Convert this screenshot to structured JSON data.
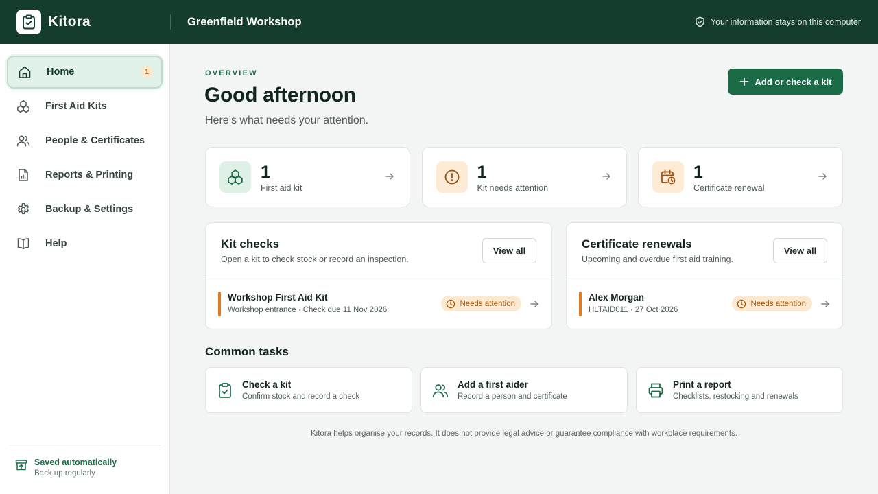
{
  "app": {
    "name": "Kitora",
    "workspace": "Greenfield Workshop",
    "privacy_note": "Your information stays on this computer"
  },
  "sidebar": {
    "items": [
      {
        "label": "Home",
        "icon": "home-icon",
        "badge": "1",
        "active": true
      },
      {
        "label": "First Aid Kits",
        "icon": "kits-icon"
      },
      {
        "label": "People & Certificates",
        "icon": "people-icon"
      },
      {
        "label": "Reports & Printing",
        "icon": "report-icon"
      },
      {
        "label": "Backup & Settings",
        "icon": "gear-icon"
      },
      {
        "label": "Help",
        "icon": "book-icon"
      }
    ],
    "status": {
      "title": "Saved automatically",
      "subtitle": "Back up regularly"
    }
  },
  "main": {
    "eyebrow": "OVERVIEW",
    "greeting": "Good afternoon",
    "subtitle": "Here’s what needs your attention.",
    "primary_action": "Add or check a kit",
    "stats": [
      {
        "value": "1",
        "label": "First aid kit",
        "icon": "kits-icon"
      },
      {
        "value": "1",
        "label": "Kit needs attention",
        "icon": "alert-circle-icon"
      },
      {
        "value": "1",
        "label": "Certificate renewal",
        "icon": "calendar-clock-icon"
      }
    ],
    "kit_checks": {
      "title": "Kit checks",
      "subtitle": "Open a kit to check stock or record an inspection.",
      "view_all": "View all",
      "rows": [
        {
          "title": "Workshop First Aid Kit",
          "meta": "Workshop entrance · Check due 11 Nov 2026",
          "status": "Needs attention"
        }
      ]
    },
    "certificate_renewals": {
      "title": "Certificate renewals",
      "subtitle": "Upcoming and overdue first aid training.",
      "view_all": "View all",
      "rows": [
        {
          "title": "Alex Morgan",
          "meta": "HLTAID011 · 27 Oct 2026",
          "status": "Needs attention"
        }
      ]
    },
    "common_tasks": {
      "title": "Common tasks",
      "items": [
        {
          "title": "Check a kit",
          "subtitle": "Confirm stock and record a check",
          "icon": "clipboard-check-icon"
        },
        {
          "title": "Add a first aider",
          "subtitle": "Record a person and certificate",
          "icon": "people-icon"
        },
        {
          "title": "Print a report",
          "subtitle": "Checklists, restocking and renewals",
          "icon": "printer-icon"
        }
      ]
    },
    "disclaimer": "Kitora helps organise your records. It does not provide legal advice or guarantee compliance with workplace requirements."
  },
  "colors": {
    "header": "#143d2e",
    "accent": "#1a6b46",
    "attention": "#e07b24",
    "attention_bg": "#fde9cf"
  }
}
